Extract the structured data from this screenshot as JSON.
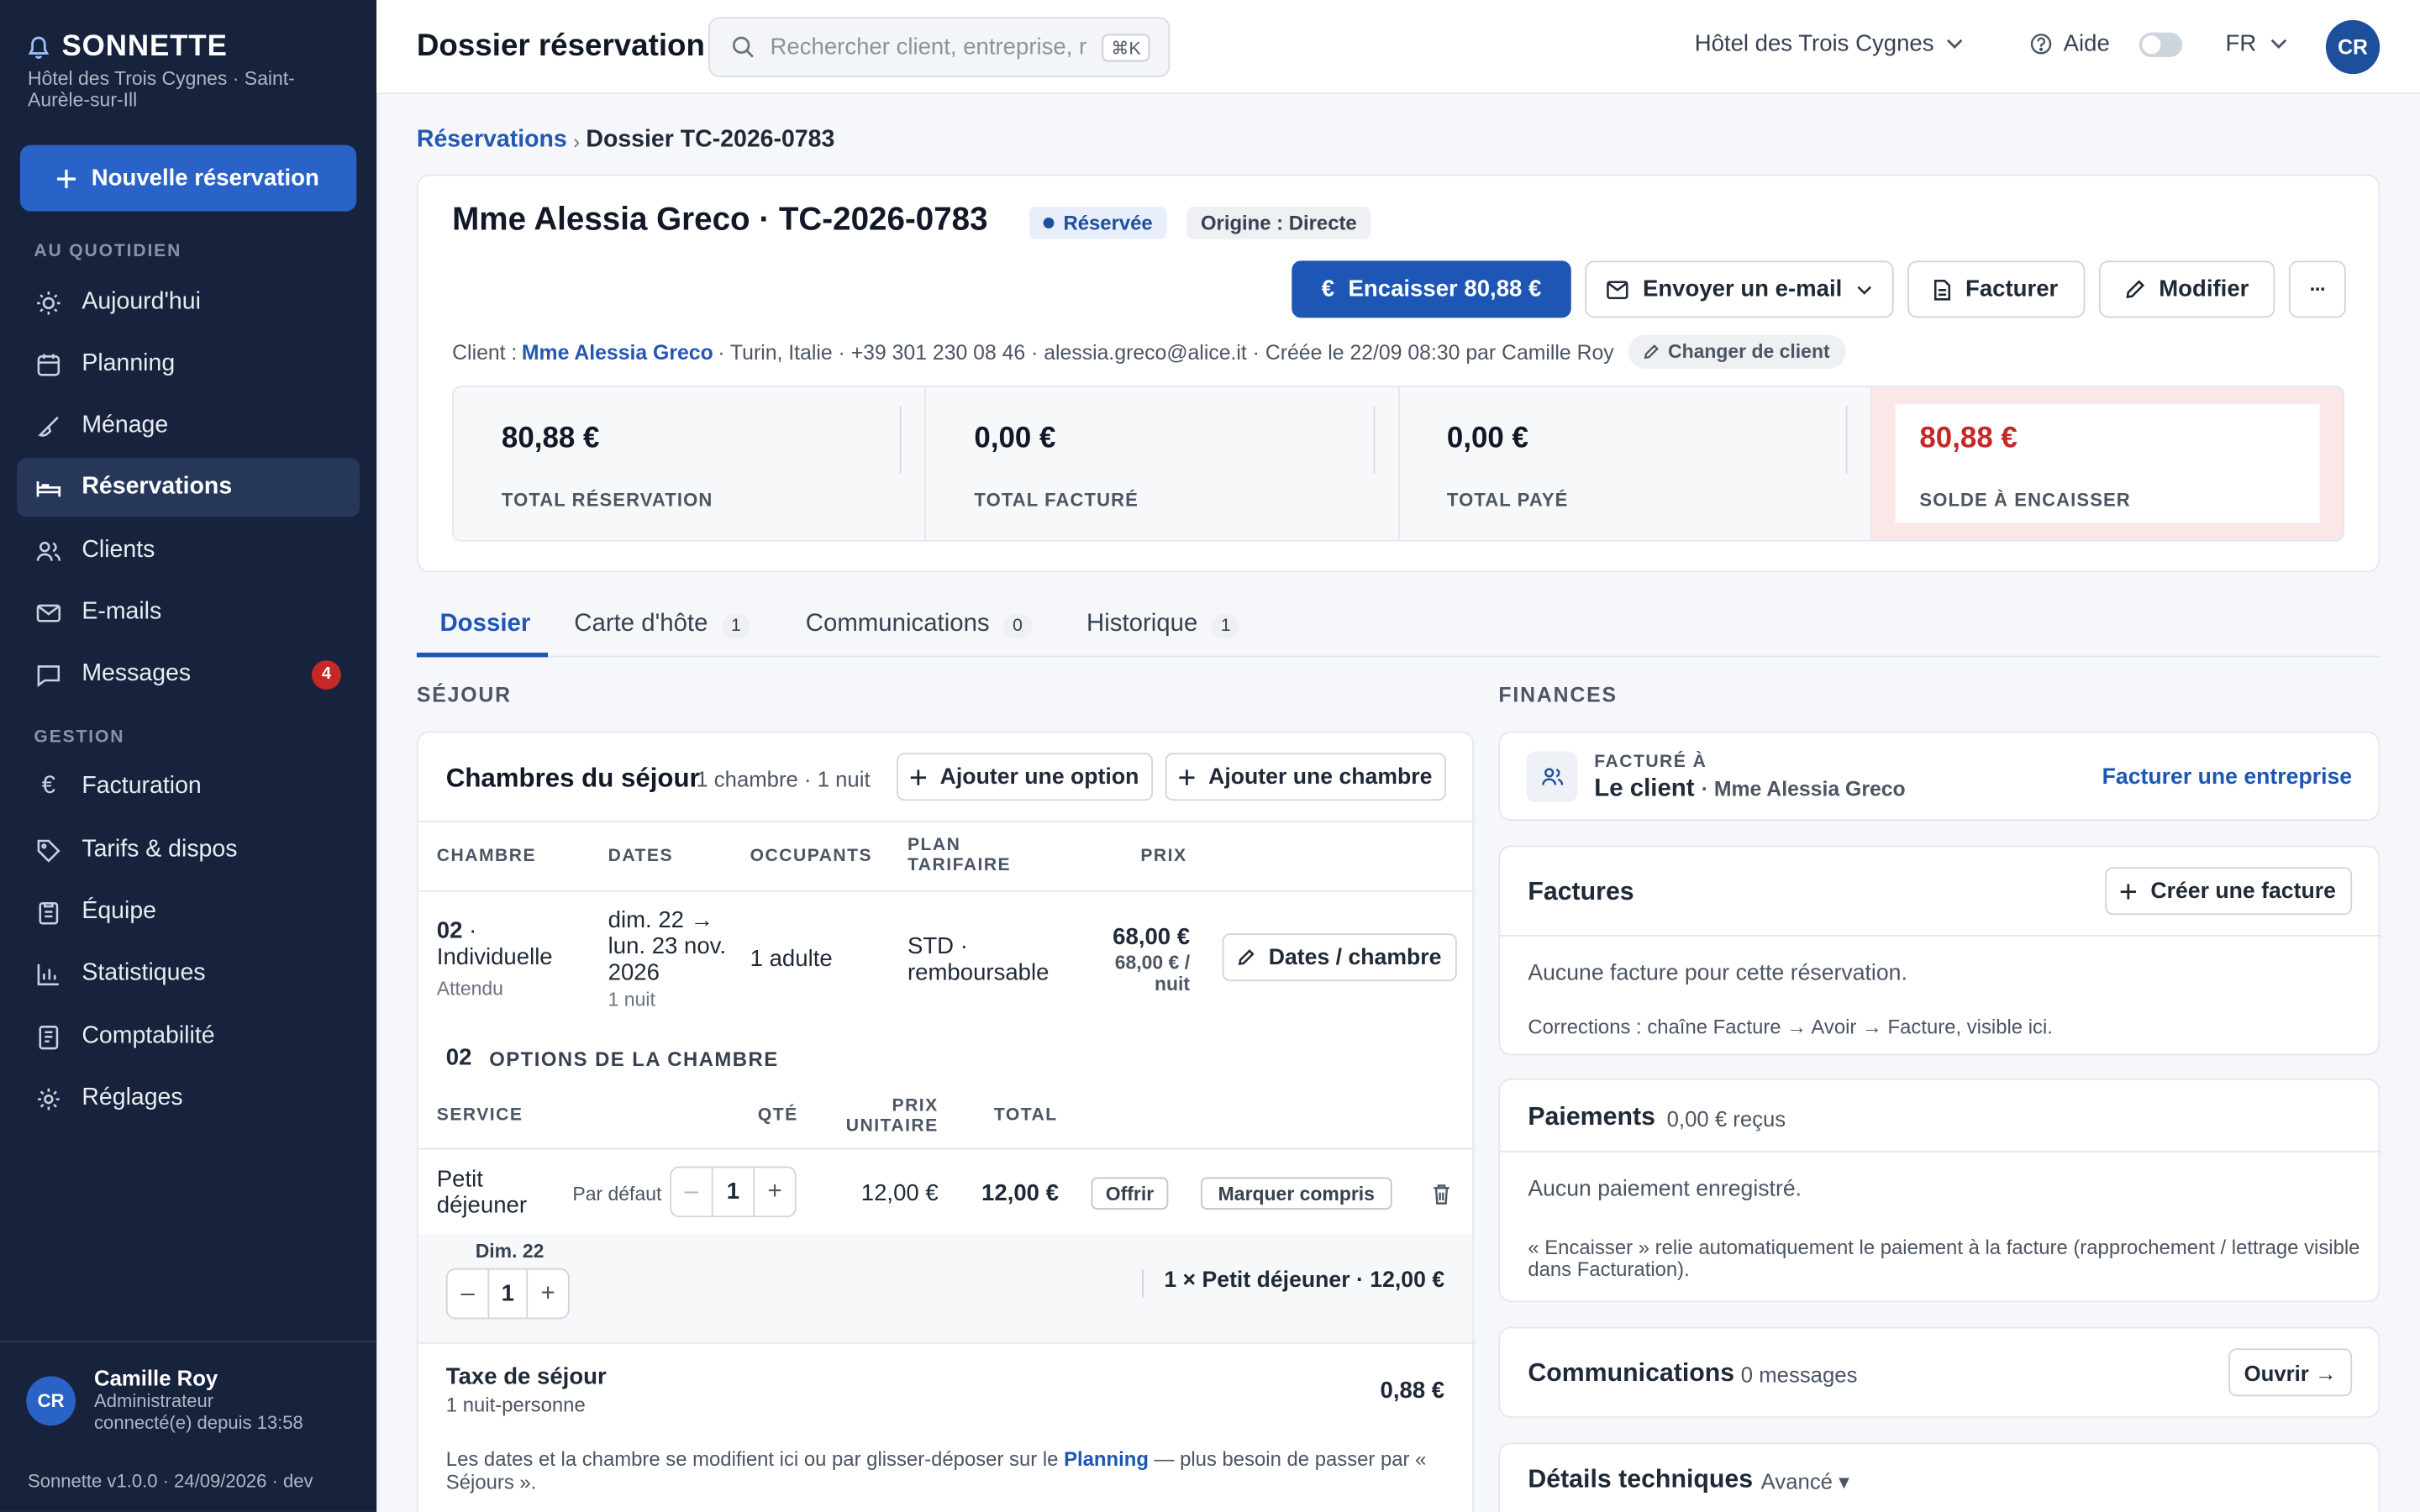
{
  "sidebar": {
    "brand": "SONNETTE",
    "hotel": "Hôtel des Trois Cygnes · Saint-Aurèle-sur-Ill",
    "new_button": "Nouvelle réservation",
    "section_daily": "AU QUOTIDIEN",
    "section_manage": "GESTION",
    "items": [
      {
        "label": "Aujourd'hui",
        "icon": "sun-icon"
      },
      {
        "label": "Planning",
        "icon": "calendar-icon"
      },
      {
        "label": "Ménage",
        "icon": "broom-icon"
      },
      {
        "label": "Réservations",
        "icon": "bed-icon",
        "active": true
      },
      {
        "label": "Clients",
        "icon": "users-icon"
      },
      {
        "label": "E-mails",
        "icon": "mail-icon"
      },
      {
        "label": "Messages",
        "icon": "chat-icon",
        "badge": "4"
      },
      {
        "label": "Facturation",
        "icon": "euro-icon"
      },
      {
        "label": "Tarifs & dispos",
        "icon": "tag-icon"
      },
      {
        "label": "Équipe",
        "icon": "clipboard-icon"
      },
      {
        "label": "Statistiques",
        "icon": "chart-icon"
      },
      {
        "label": "Comptabilité",
        "icon": "ledger-icon"
      },
      {
        "label": "Réglages",
        "icon": "gear-icon"
      }
    ],
    "user": {
      "initials": "CR",
      "name": "Camille Roy",
      "role": "Administrateur",
      "connected": "connecté(e) depuis 13:58"
    },
    "version": "Sonnette v1.0.0 · 24/09/2026 · dev"
  },
  "topbar": {
    "title": "Dossier réservation",
    "search_placeholder": "Rechercher client, entreprise, réservation",
    "search_shortcut": "⌘K",
    "hotel": "Hôtel des Trois Cygnes",
    "help": "Aide",
    "lang": "FR",
    "avatar": "CR"
  },
  "breadcrumb": {
    "parent": "Réservations",
    "sep": "›",
    "current": "Dossier TC-2026-0783"
  },
  "header": {
    "title": "Mme Alessia Greco · TC-2026-0783",
    "status": "Réservée",
    "origin": "Origine : Directe",
    "btn_cash": "Encaisser 80,88 €",
    "btn_email": "Envoyer un e-mail",
    "btn_invoice": "Facturer",
    "btn_edit": "Modifier",
    "btn_more": "···",
    "client_prefix": "Client :",
    "client_name": "Mme Alessia Greco",
    "client_details": "· Turin, Italie · +39 301 230 08 46 · alessia.greco@alice.it · Créée le 22/09 08:30 par Camille Roy",
    "change_client": "Changer de client"
  },
  "totals": [
    {
      "amount": "80,88 €",
      "label": "TOTAL RÉSERVATION"
    },
    {
      "amount": "0,00 €",
      "label": "TOTAL FACTURÉ"
    },
    {
      "amount": "0,00 €",
      "label": "TOTAL PAYÉ"
    },
    {
      "amount": "80,88 €",
      "label": "SOLDE À ENCAISSER"
    }
  ],
  "tabs": [
    {
      "label": "Dossier"
    },
    {
      "label": "Carte d'hôte",
      "count": "1"
    },
    {
      "label": "Communications",
      "count": "0"
    },
    {
      "label": "Historique",
      "count": "1"
    }
  ],
  "stay": {
    "section": "SÉJOUR",
    "title": "Chambres du séjour",
    "summary": "1 chambre · 1 nuit",
    "btn_add_option": "Ajouter une option",
    "btn_add_room": "Ajouter une chambre",
    "columns": [
      "CHAMBRE",
      "DATES",
      "OCCUPANTS",
      "PLAN TARIFAIRE",
      "PRIX"
    ],
    "room": {
      "number": "02",
      "type": "Individuelle",
      "status": "Attendu",
      "dates": "dim. 22 → lun. 23 nov. 2026",
      "nights": "1 nuit",
      "occupants": "1 adulte",
      "plan": "STD · remboursable",
      "price": "68,00 €",
      "price_night": "68,00 € / nuit",
      "btn": "Dates / chambre"
    },
    "options_number": "02",
    "options_title": "OPTIONS DE LA CHAMBRE",
    "option_columns": [
      "SERVICE",
      "QTÉ",
      "PRIX UNITAIRE",
      "TOTAL"
    ],
    "option": {
      "service": "Petit déjeuner",
      "default": "Par défaut",
      "qty": "1",
      "unit": "12,00 €",
      "total": "12,00 €",
      "offer": "Offrir",
      "included": "Marquer compris",
      "day": "Dim. 22",
      "day_qty": "1",
      "summary": "1 × Petit déjeuner · 12,00 €"
    },
    "tax_title": "Taxe de séjour",
    "tax_sub": "1 nuit-personne",
    "tax_amount": "0,88 €",
    "note_before": "Les dates et la chambre se modifient ici ou par glisser-déposer sur le",
    "note_link": "Planning",
    "note_after": "— plus besoin de passer par « Séjours »."
  },
  "finances": {
    "section": "FINANCES",
    "billed_label": "FACTURÉ À",
    "billed_to": "Le client",
    "billed_name": "· Mme Alessia Greco",
    "bill_company": "Facturer une entreprise",
    "invoices_title": "Factures",
    "create_invoice": "Créer une facture",
    "no_invoice": "Aucune facture pour cette réservation.",
    "corrections": "Corrections : chaîne Facture → Avoir → Facture, visible ici.",
    "payments_title": "Paiements",
    "payments_received": "0,00 € reçus",
    "no_payment": "Aucun paiement enregistré.",
    "payment_note": "« Encaisser » relie automatiquement le paiement à la facture (rapprochement / lettrage visible dans Facturation).",
    "comms_title": "Communications",
    "comms_count": "0 messages",
    "open": "Ouvrir →",
    "tech_title": "Détails techniques",
    "advanced": "Avancé ▾"
  }
}
